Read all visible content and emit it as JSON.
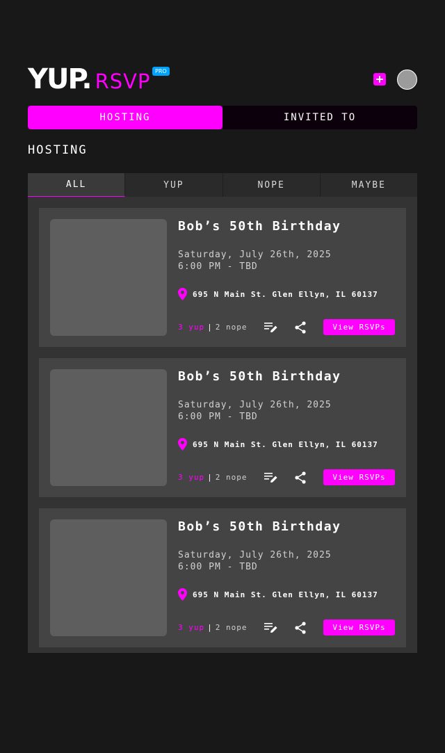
{
  "brand": {
    "name": "YUP.",
    "product": "RSVP",
    "badge": "PRO"
  },
  "colors": {
    "accent": "#ff00ff",
    "badge": "#00a2ff",
    "background": "#181818",
    "card": "#444444"
  },
  "header": {
    "add_icon": "plus-icon",
    "avatar": "avatar"
  },
  "main_tabs": [
    {
      "label": "HOSTING",
      "active": true
    },
    {
      "label": "INVITED TO",
      "active": false
    }
  ],
  "section_title": "HOSTING",
  "filter_tabs": [
    {
      "label": "ALL",
      "active": true
    },
    {
      "label": "YUP",
      "active": false
    },
    {
      "label": "NOPE",
      "active": false
    },
    {
      "label": "MAYBE",
      "active": false
    }
  ],
  "events": [
    {
      "title": "Bob’s 50th Birthday",
      "date": "Saturday, July 26th, 2025",
      "time": "6:00 PM - TBD",
      "location": "695 N Main St. Glen Ellyn, IL 60137",
      "yup_count": "3 yup",
      "separator": "|",
      "nope_count": "2 nope",
      "view_label": "View RSVPs"
    },
    {
      "title": "Bob’s 50th Birthday",
      "date": "Saturday, July 26th, 2025",
      "time": "6:00 PM - TBD",
      "location": "695 N Main St. Glen Ellyn, IL 60137",
      "yup_count": "3 yup",
      "separator": "|",
      "nope_count": "2 nope",
      "view_label": "View RSVPs"
    },
    {
      "title": "Bob’s 50th Birthday",
      "date": "Saturday, July 26th, 2025",
      "time": "6:00 PM - TBD",
      "location": "695 N Main St. Glen Ellyn, IL 60137",
      "yup_count": "3 yup",
      "separator": "|",
      "nope_count": "2 nope",
      "view_label": "View RSVPs"
    }
  ]
}
